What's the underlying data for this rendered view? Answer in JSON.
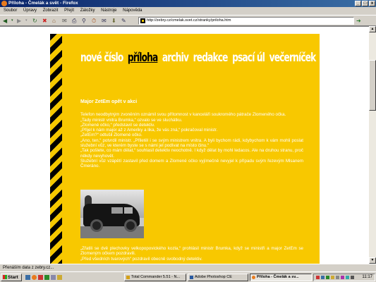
{
  "window": {
    "title": "Příloha - Čmelák a svět - Firefox",
    "url": "http://zebry.cz/cmelak.svet.cz/stranky/priloha.htm"
  },
  "menu": [
    "Soubor",
    "Úpravy",
    "Zobrazit",
    "Přejít",
    "Záložky",
    "Nástroje",
    "Nápověda"
  ],
  "site_nav": [
    {
      "label": "nové číslo",
      "active": false
    },
    {
      "label": "příloha",
      "active": true
    },
    {
      "label": "archiv",
      "active": false
    },
    {
      "label": "redakce",
      "active": false
    },
    {
      "label": "psací úl",
      "active": false
    },
    {
      "label": "večerníček",
      "active": false
    }
  ],
  "article": {
    "heading": "Major ZetEm opět v akci",
    "paragraphs": [
      "Telefon neodbytným zvoněním oznámil svou přítomnost v kanceláři soukromého pátrače Zlomeného očka.",
      "„Tady ministr vnitra Brumka,“ ozvalo se ve sluchátku.",
      "„Zlomené očko,“ představil se detektiv.",
      "„Přijel k nám major až z Ameriky a lika, že vás zná,“ pokračoval ministr.",
      "„ZetEm?“ odtušil Zlomené očko.",
      "„Ano, ten,“ potvrdil ministr. „Přiletěl i se svým ministrem vnitra. A byli bychom rádi, kdybychom k vám mohli poslat služební vůz, ve kterém byste se s námi jel podívat na místo činu.“",
      "„Tak pošlete, co mám dělat,“ souhlasil detektiv neochotně. I když dělat by mohl ledacos. Ale na druhou stranu, proč někdy nevyhovět.",
      "Služební vůz vzápětí zastavil před domem a Zlomené očko vyjímečně nevyjel k případu svým řezevým Mlsanem Čmeráno."
    ],
    "after_photo": [
      "„Zřatili se dvě plechovky velkopopovického kozla,“ prohlásil ministr Brumka, když se ministři a major ZetEm se Zlomeným očkem pozdravili.",
      "„Před všedních tvarových“ pozdravil obecně svobodný detektiv."
    ],
    "photo_alt": "old-car-photo"
  },
  "status_text": "Přenáším data z zebry.cz...",
  "taskbar": {
    "start_label": "Start",
    "tasks": [
      {
        "label": "Total Commander 5.51 - N...",
        "active": false
      },
      {
        "label": "Adobe Photoshop CE",
        "active": false
      },
      {
        "label": "Příloha - Čmelák a sv...",
        "active": true
      }
    ],
    "clock": "11:17"
  },
  "colors": {
    "page_yellow": "#f8c800",
    "nav_white": "#ffffff",
    "nav_active": "#000000",
    "titlebar": "#0a246a"
  }
}
